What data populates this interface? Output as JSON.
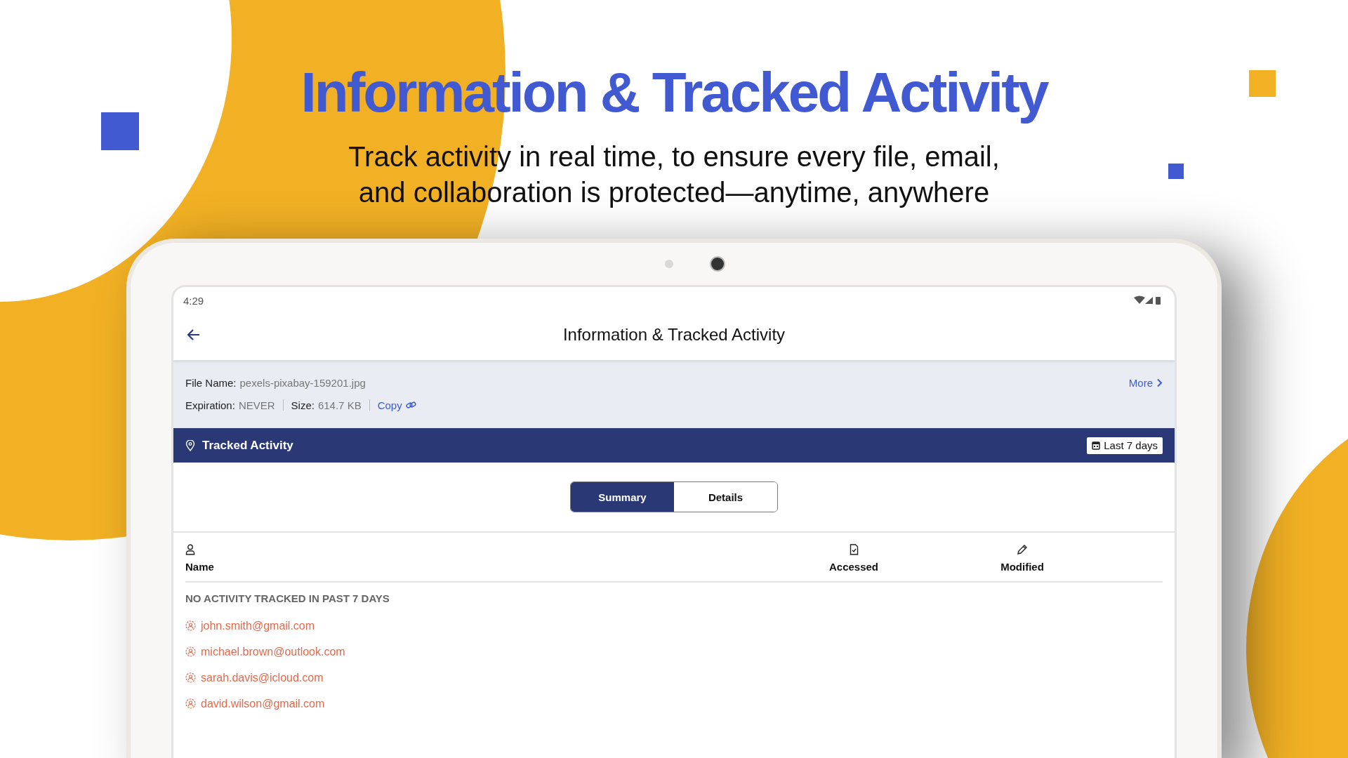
{
  "headline": "Information & Tracked Activity",
  "subheadline": [
    "Track activity in real time, to ensure every file, email,",
    "and collaboration is protected—anytime, anywhere"
  ],
  "device": {
    "status_bar": {
      "time": "4:29"
    },
    "toolbar": {
      "title": "Information & Tracked Activity"
    },
    "file_info": {
      "file_name_label": "File Name:",
      "file_name": "pexels-pixabay-159201.jpg",
      "more_link": "More",
      "expiration_label": "Expiration:",
      "expiration": "NEVER",
      "size_label": "Size:",
      "size": "614.7 KB",
      "copy_link": "Copy"
    },
    "tracked_activity": {
      "title": "Tracked Activity",
      "date_range": "Last 7 days"
    },
    "tabs": [
      {
        "label": "Summary",
        "selected": true
      },
      {
        "label": "Details",
        "selected": false
      }
    ],
    "table": {
      "columns": [
        {
          "label": "Name",
          "kind": "person"
        },
        {
          "label": "Accessed",
          "kind": "file"
        },
        {
          "label": "Modified",
          "kind": "pencil"
        }
      ],
      "empty_message": "NO ACTIVITY TRACKED IN PAST 7 DAYS",
      "recipients": [
        "john.smith@gmail.com",
        "michael.brown@outlook.com",
        "sarah.davis@icloud.com",
        "david.wilson@gmail.com"
      ]
    }
  }
}
